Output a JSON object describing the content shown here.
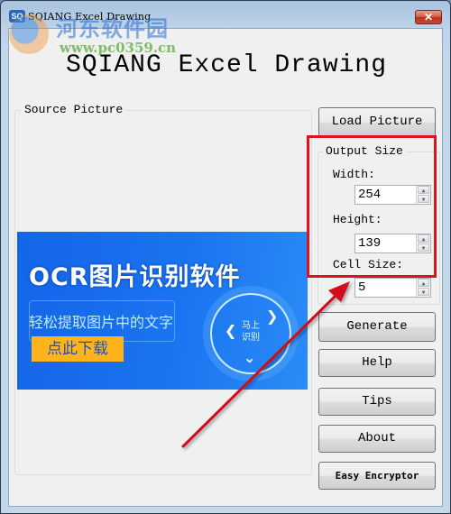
{
  "window": {
    "title": "SQIANG Excel Drawing",
    "app_icon_text": "SQ",
    "close_glyph": "✕"
  },
  "watermark": {
    "site_name": "河东软件园",
    "url": "www.pc0359.cn"
  },
  "heading": "SQIANG Excel Drawing",
  "source_picture": {
    "group_label": "Source Picture",
    "image": {
      "title": "OCR图片识别软件",
      "subtitle": "轻松提取图片中的文字",
      "button": "点此下载",
      "circle_text_line1": "马上",
      "circle_text_line2": "识别"
    }
  },
  "buttons": {
    "load_picture": "Load Picture",
    "generate": "Generate",
    "help": "Help",
    "tips": "Tips",
    "about": "About",
    "easy_encryptor": "Easy Encryptor"
  },
  "output_size": {
    "group_label": "Output Size",
    "width_label": "Width:",
    "width_value": "254",
    "height_label": "Height:",
    "height_value": "139",
    "cell_size_label": "Cell Size:",
    "cell_size_value": "5",
    "spin_up_glyph": "▲",
    "spin_down_glyph": "▼"
  },
  "annotation": {
    "highlight_color": "#e0121a",
    "arrow_color": "#d0101c"
  }
}
